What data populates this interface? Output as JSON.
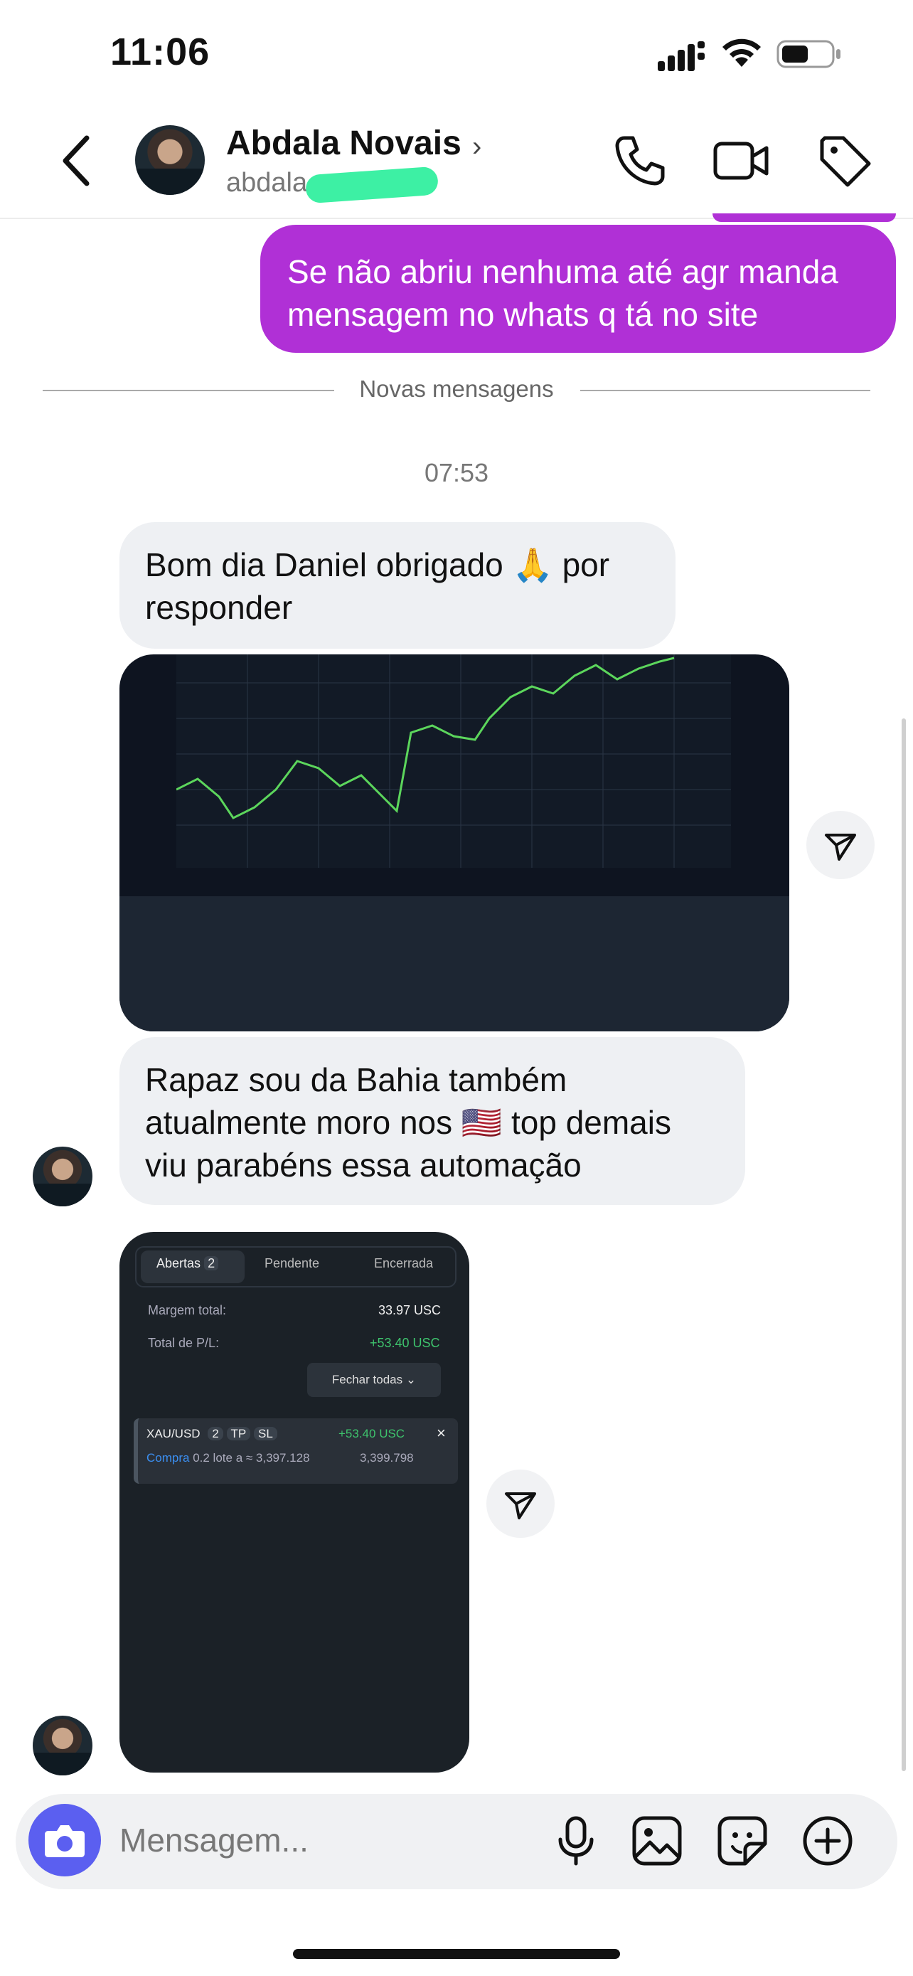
{
  "status_bar": {
    "time": "11:06"
  },
  "header": {
    "contact_name": "Abdala Novais",
    "username": "abdala",
    "chevron": "›"
  },
  "messages": {
    "outgoing_1": "Se não abriu nenhuma até agr manda mensagem no whats q tá no site",
    "new_messages_label": "Novas mensagens",
    "timestamp": "07:53",
    "incoming_1": "Bom dia Daniel obrigado 🙏 por responder",
    "incoming_2": "Rapaz sou da Bahia também atualmente moro nos 🇺🇸  top demais viu parabéns essa automação"
  },
  "trade_screenshot": {
    "tabs": [
      "Abertas",
      "Pendente",
      "Encerrada"
    ],
    "open_count": "2",
    "margin_label": "Margem total:",
    "margin_value": "33.97 USC",
    "pl_label": "Total de P/L:",
    "pl_value": "+53.40 USC",
    "close_all": "Fechar todas",
    "position_symbol": "XAU/USD",
    "position_count": "2",
    "tp": "TP",
    "sl": "SL",
    "position_pl": "+53.40 USC",
    "position_side": "Compra",
    "position_detail": "0.2 lote a ≈ 3,397.128",
    "position_price": "3,399.798"
  },
  "composer": {
    "placeholder": "Mensagem..."
  },
  "icons": [
    "signal-icon",
    "wifi-icon",
    "battery-icon",
    "back-icon",
    "phone-icon",
    "video-icon",
    "tag-icon",
    "share-icon",
    "camera-icon",
    "microphone-icon",
    "gallery-icon",
    "sticker-icon",
    "plus-icon"
  ],
  "colors": {
    "outgoing_bubble": "#b030d6",
    "incoming_bubble": "#eef0f3",
    "camera_button": "#5b5ff0",
    "profit_green": "#3ec46d"
  }
}
